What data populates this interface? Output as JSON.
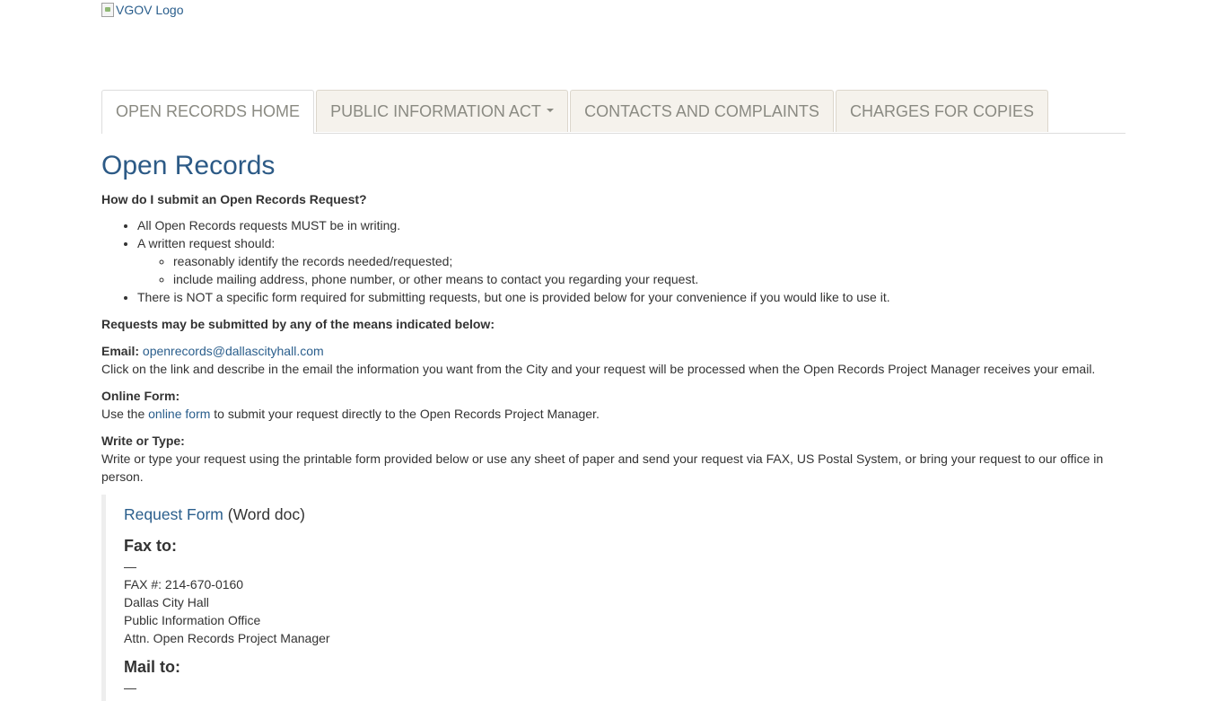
{
  "logo": {
    "alt": "VGOV Logo"
  },
  "tabs": [
    {
      "label": "OPEN RECORDS HOME",
      "active": true
    },
    {
      "label": "PUBLIC INFORMATION ACT",
      "dropdown": true
    },
    {
      "label": "CONTACTS AND COMPLAINTS"
    },
    {
      "label": "CHARGES FOR COPIES"
    }
  ],
  "page": {
    "title": "Open Records",
    "question": "How do I submit an Open Records Request?",
    "bullets": {
      "b1": "All Open Records requests MUST be in writing.",
      "b2": "A written request should:",
      "b2_sub1": "reasonably identify the records needed/requested;",
      "b2_sub2": "include mailing address, phone number, or other means to contact you regarding your request.",
      "b3": "There is NOT a specific form required for submitting requests, but one is provided below for your convenience if you would like to use it."
    },
    "means_heading": "Requests may be submitted by any of the means indicated below:",
    "email": {
      "label": "Email:",
      "address": "openrecords@dallascityhall.com",
      "text": "Click on the link and describe in the email the information you want from the City and your request will be processed when the Open Records Project Manager receives your email."
    },
    "online": {
      "label": "Online Form:",
      "before": "Use the",
      "link": "online form",
      "after": "to submit your request directly to the Open Records Project Manager."
    },
    "write": {
      "label": "Write or Type:",
      "text_line1": "Write or type your request using the printable form provided below or use any sheet of paper and send your request via FAX, US Postal System, or bring your request to our office in",
      "text_line2": "person."
    },
    "form": {
      "link": "Request Form",
      "ext": "(Word doc)",
      "fax_heading": "Fax to:",
      "dash": "—",
      "fax_lines": [
        "FAX #: 214-670-0160",
        "Dallas City Hall",
        "Public Information Office",
        "Attn. Open Records Project Manager"
      ],
      "mail_heading": "Mail to:",
      "mail_dash": "—"
    }
  }
}
